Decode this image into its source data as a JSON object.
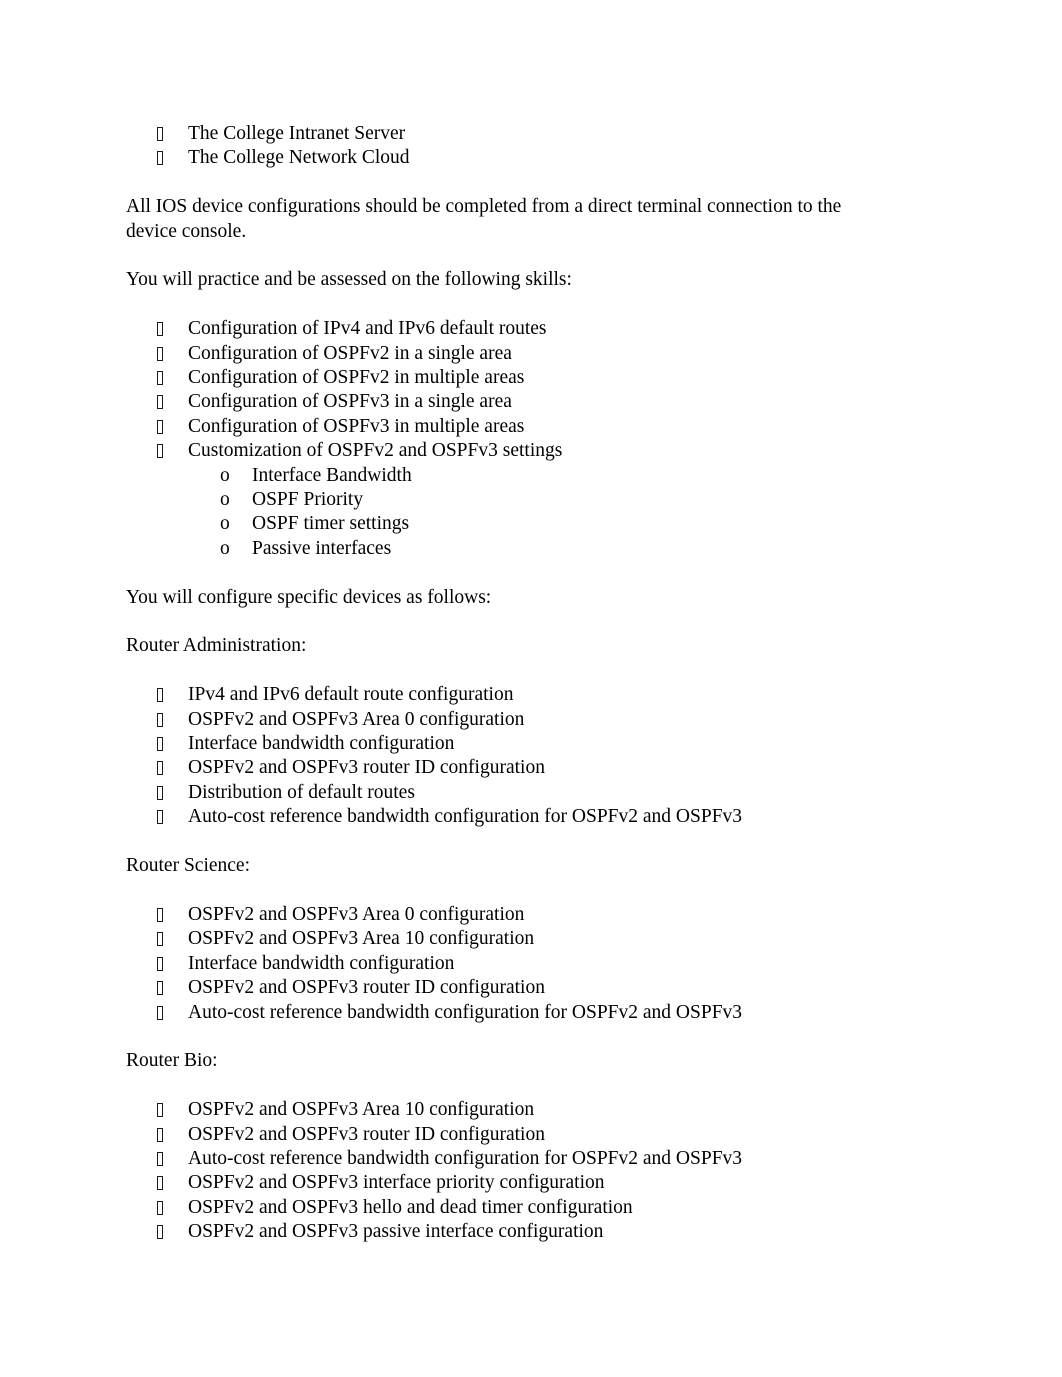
{
  "document": {
    "bullet_marker_glyph": "missing-glyph-box",
    "sub_bullet_marker_glyph": "o",
    "text_color": "#000000",
    "page_background": "#ffffff"
  },
  "content": {
    "intro_list": [
      {
        "text": "The College Intranet Server"
      },
      {
        "text": "The College Network Cloud"
      }
    ],
    "para_ios": "All IOS device configurations should be completed from a direct terminal connection to the device console.",
    "para_skills_intro": "You will practice and be assessed on the following skills:",
    "skills_list": [
      {
        "text": "Configuration of IPv4 and IPv6 default routes"
      },
      {
        "text": "Configuration of OSPFv2 in a single area"
      },
      {
        "text": "Configuration of OSPFv2 in multiple areas"
      },
      {
        "text": "Configuration of OSPFv3 in a single area"
      },
      {
        "text": "Configuration of OSPFv3 in multiple areas"
      },
      {
        "text": "Customization of OSPFv2 and OSPFv3 settings"
      }
    ],
    "skills_sublist": [
      {
        "marker": "o",
        "text": "Interface Bandwidth"
      },
      {
        "marker": "o",
        "text": "OSPF Priority"
      },
      {
        "marker": "o",
        "text": "OSPF timer settings"
      },
      {
        "marker": "o",
        "text": "Passive interfaces"
      }
    ],
    "para_devices_intro": "You will configure specific devices as follows:",
    "router_admin": {
      "heading": "Router Administration:",
      "items": [
        {
          "text": "IPv4 and IPv6 default route configuration"
        },
        {
          "text": "OSPFv2 and OSPFv3 Area 0 configuration"
        },
        {
          "text": "Interface bandwidth configuration"
        },
        {
          "text": "OSPFv2 and OSPFv3 router ID configuration"
        },
        {
          "text": "Distribution of default routes"
        },
        {
          "text": "Auto-cost reference bandwidth configuration for OSPFv2 and OSPFv3"
        }
      ]
    },
    "router_science": {
      "heading": "Router Science:",
      "items": [
        {
          "text": "OSPFv2 and OSPFv3 Area 0 configuration"
        },
        {
          "text": "OSPFv2 and OSPFv3 Area 10 configuration"
        },
        {
          "text": "Interface bandwidth configuration"
        },
        {
          "text": "OSPFv2 and OSPFv3 router ID configuration"
        },
        {
          "text": "Auto-cost reference bandwidth configuration for OSPFv2 and OSPFv3"
        }
      ]
    },
    "router_bio": {
      "heading": "Router Bio:",
      "items": [
        {
          "text": "OSPFv2 and OSPFv3 Area 10 configuration"
        },
        {
          "text": "OSPFv2 and OSPFv3 router ID configuration"
        },
        {
          "text": "Auto-cost reference bandwidth configuration for OSPFv2 and OSPFv3"
        },
        {
          "text": "OSPFv2 and OSPFv3 interface priority configuration"
        },
        {
          "text": "OSPFv2 and OSPFv3 hello and dead timer configuration"
        },
        {
          "text": "OSPFv2 and OSPFv3 passive interface configuration"
        }
      ]
    }
  }
}
